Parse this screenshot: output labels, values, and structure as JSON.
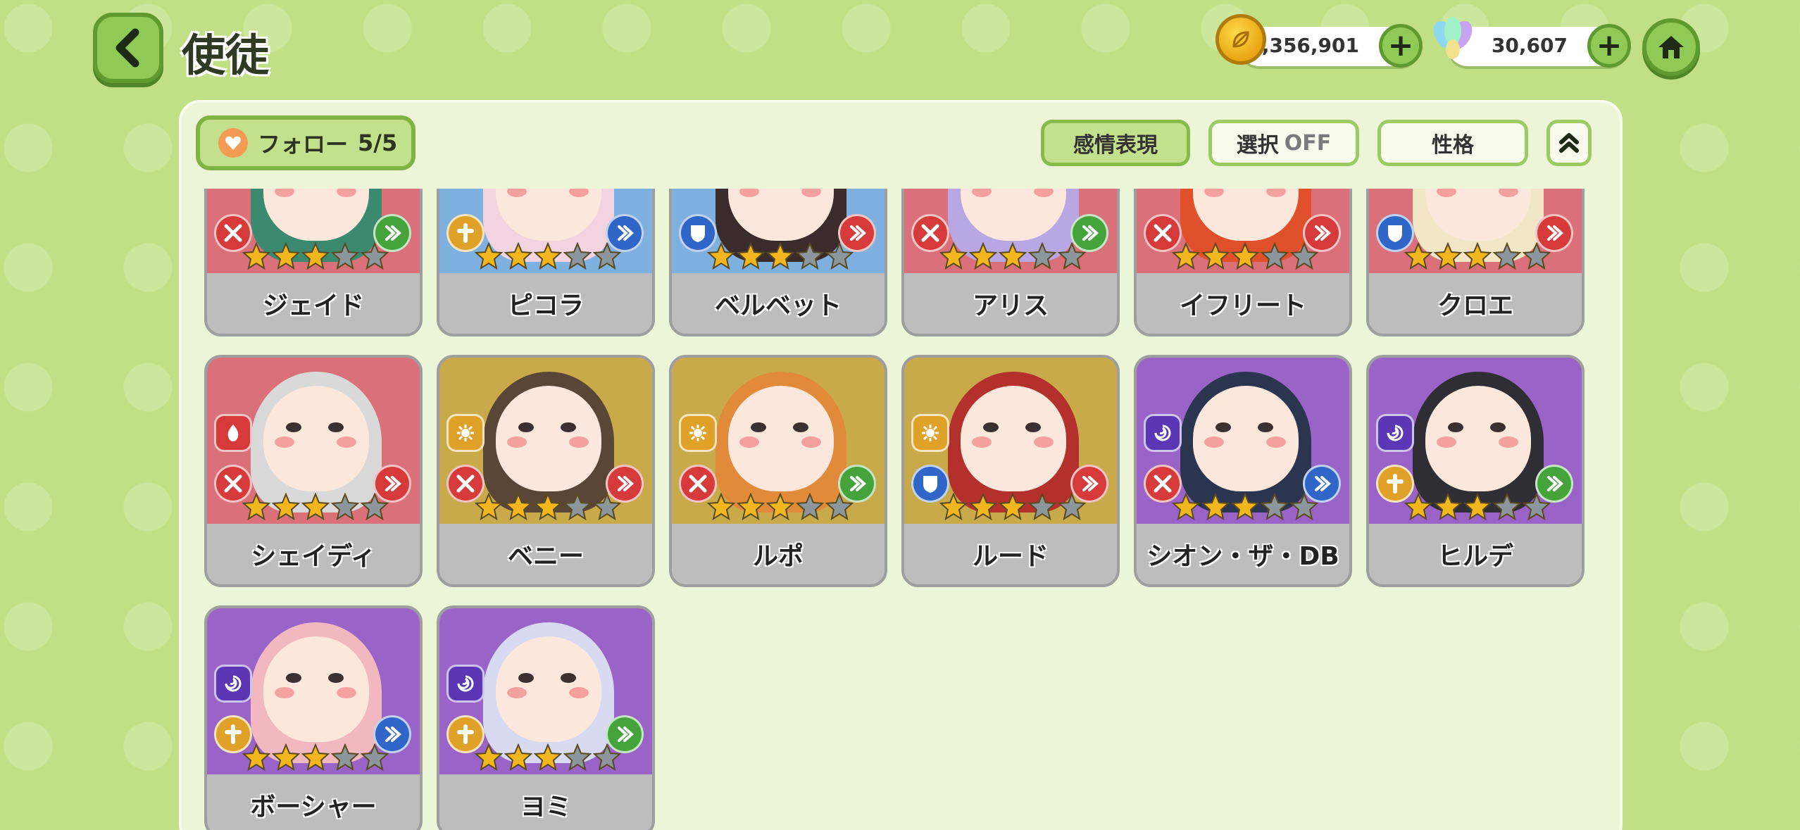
{
  "header": {
    "title": "使徒",
    "gold": "1,356,901",
    "gems": "30,607"
  },
  "toolbar": {
    "follow_label": "フォロー",
    "follow_count": "5/5",
    "emotion_label": "感情表現",
    "select_label": "選択",
    "select_state": "OFF",
    "personality_label": "性格"
  },
  "colors": {
    "bg": "#c1e085",
    "red": "#d9707a",
    "blue": "#7fb1e0",
    "yellow": "#c8aa4a",
    "purple": "#9a63c7",
    "star_on": "#f2b71f",
    "star_off": "#8c969d",
    "badge_red": "#d63a3a",
    "badge_gold": "#e0a128",
    "badge_blue": "#2f66c7",
    "badge_green": "#45a33c",
    "badge_purple": "#5b36b5"
  },
  "characters": [
    {
      "name": "ジェイド",
      "bg": "red",
      "hair": "#3b8a6f",
      "stars": 3,
      "role": "sword-icon",
      "arrow": "green"
    },
    {
      "name": "ピコラ",
      "bg": "blue",
      "hair": "#f2d3e0",
      "stars": 3,
      "role": "heal-icon",
      "arrow": "blue"
    },
    {
      "name": "ベルベット",
      "bg": "blue",
      "hair": "#3b2b2b",
      "stars": 3,
      "role": "shield-icon",
      "arrow": "red"
    },
    {
      "name": "アリス",
      "bg": "red",
      "hair": "#b9a7e3",
      "stars": 3,
      "role": "sword-icon",
      "arrow": "green"
    },
    {
      "name": "イフリート",
      "bg": "red",
      "hair": "#e0502a",
      "stars": 3,
      "role": "sword-icon",
      "arrow": "red"
    },
    {
      "name": "クロエ",
      "bg": "red",
      "hair": "#f2e6c7",
      "stars": 3,
      "role": "shield-icon",
      "arrow": "red"
    },
    {
      "name": "シェイディ",
      "bg": "red",
      "hair": "#d9d9d9",
      "stars": 3,
      "elem": "fire",
      "role": "sword-icon",
      "arrow": "red"
    },
    {
      "name": "ベニー",
      "bg": "yellow",
      "hair": "#5a4636",
      "stars": 3,
      "elem": "light",
      "role": "sword-icon",
      "arrow": "red"
    },
    {
      "name": "ルポ",
      "bg": "yellow",
      "hair": "#e08a3a",
      "stars": 3,
      "elem": "light",
      "role": "sword-icon",
      "arrow": "green"
    },
    {
      "name": "ルード",
      "bg": "yellow",
      "hair": "#b3302d",
      "stars": 3,
      "elem": "light",
      "role": "shield-icon",
      "arrow": "red"
    },
    {
      "name": "シオン・ザ・DB",
      "bg": "purple",
      "hair": "#2b3550",
      "stars": 3,
      "elem": "dark",
      "role": "sword-icon",
      "arrow": "blue"
    },
    {
      "name": "ヒルデ",
      "bg": "purple",
      "hair": "#2e2e34",
      "stars": 3,
      "elem": "dark",
      "role": "heal-icon",
      "arrow": "green"
    },
    {
      "name": "ボーシャー",
      "bg": "purple",
      "hair": "#f2b8c0",
      "stars": 3,
      "elem": "dark",
      "role": "heal-icon",
      "arrow": "blue"
    },
    {
      "name": "ヨミ",
      "bg": "purple",
      "hair": "#d8daf2",
      "stars": 3,
      "elem": "dark",
      "role": "heal-icon",
      "arrow": "green"
    }
  ]
}
